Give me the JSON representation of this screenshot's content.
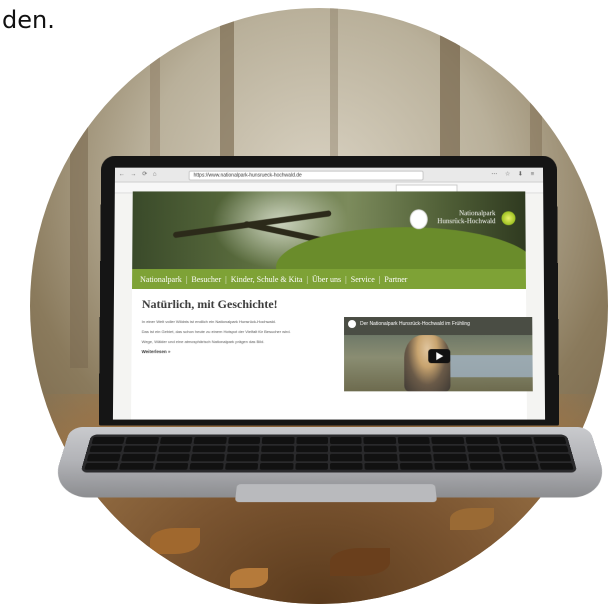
{
  "corner_text": "den.",
  "browser": {
    "url": "https://www.nationalpark-hunsrueck-hochwald.de",
    "nav_glyphs": "← → ⟳ ⌂",
    "right_glyphs": "⋯ ☆ ⬇ ≡"
  },
  "site": {
    "logo": {
      "text_line1": "Nationalpark",
      "text_line2": "Hunsrück-Hochwald"
    },
    "menu": [
      "Nationalpark",
      "Besucher",
      "Kinder, Schule & Kita",
      "Über uns",
      "Service",
      "Partner"
    ],
    "headline": "Natürlich, mit Geschichte!",
    "paragraphs": [
      "In einer Welt voller Wildnis ist endlich ein Nationalpark Hunsrück-Hochwald.",
      "Das ist ein Gebiet, das schon heute zu einem Hotspot der Vielfalt für Besucher wird.",
      "Wege, Wälder und eine atmosphärisch Nationalpark prägen das Bild."
    ],
    "more_link": "Weiterlesen »",
    "video_title": "Der Nationalpark Hunsrück-Hochwald im Frühling"
  }
}
